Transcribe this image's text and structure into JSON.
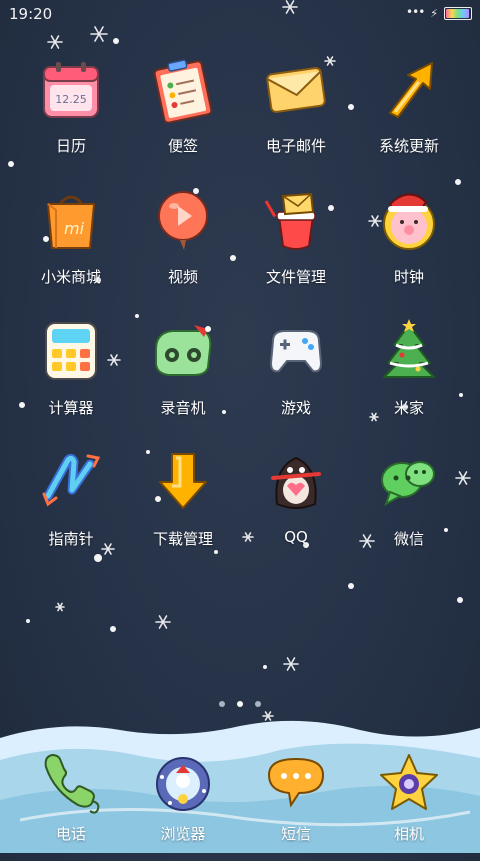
{
  "status_bar": {
    "time": "19:20"
  },
  "apps": [
    {
      "label": "日历",
      "icon": "calendar-icon",
      "icon_text": "12.25"
    },
    {
      "label": "便签",
      "icon": "notes-icon"
    },
    {
      "label": "电子邮件",
      "icon": "email-icon"
    },
    {
      "label": "系统更新",
      "icon": "system-update-icon"
    },
    {
      "label": "小米商城",
      "icon": "mi-store-icon",
      "icon_text": "mi"
    },
    {
      "label": "视频",
      "icon": "video-icon"
    },
    {
      "label": "文件管理",
      "icon": "file-manager-icon"
    },
    {
      "label": "时钟",
      "icon": "clock-icon"
    },
    {
      "label": "计算器",
      "icon": "calculator-icon"
    },
    {
      "label": "录音机",
      "icon": "recorder-icon"
    },
    {
      "label": "游戏",
      "icon": "game-icon"
    },
    {
      "label": "米家",
      "icon": "mi-home-icon"
    },
    {
      "label": "指南针",
      "icon": "compass-icon"
    },
    {
      "label": "下载管理",
      "icon": "download-manager-icon"
    },
    {
      "label": "QQ",
      "icon": "qq-icon"
    },
    {
      "label": "微信",
      "icon": "wechat-icon"
    }
  ],
  "pager": {
    "page_count": 3,
    "active_index": 1
  },
  "dock": [
    {
      "label": "电话",
      "icon": "phone-icon"
    },
    {
      "label": "浏览器",
      "icon": "browser-icon"
    },
    {
      "label": "短信",
      "icon": "messages-icon"
    },
    {
      "label": "相机",
      "icon": "camera-icon"
    }
  ],
  "colors": {
    "wallpaper": "#263247",
    "snow": "#ffffff",
    "dock_ice": "#d6ecf5"
  }
}
